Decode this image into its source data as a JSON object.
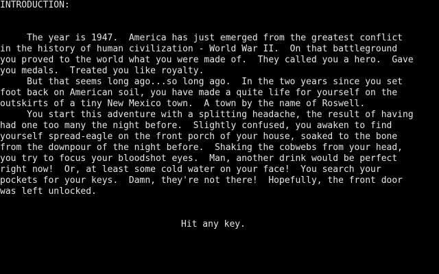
{
  "screen": {
    "heading": "INTRODUCTION:",
    "lines": [
      "     The year is 1947.  America has just emerged from the greatest conflict",
      "in the history of human civilization - World War II.  On that battleground",
      "you proved to the world what you were made of.  They called you a hero.  Gave",
      "you medals.  Treated you like royalty.",
      "     But that seems long ago...so long ago.  In the two years since you set",
      "foot back on American soil, you have made a quite life for yourself on the",
      "outskirts of a tiny New Mexico town.  A town by the name of Roswell.",
      "     You start this adventure with a splitting headache, the result of having",
      "had one too many the night before.  Slightly confused, you awaken to find",
      "yourself spread-eagle on the front porch of your house, soaked to the bone",
      "from the downpour of the night before.  Shaking the cobwebs from your head,",
      "you try to focus your bloodshot eyes.  Man, another drink would be perfect",
      "right now!  Or, at least some cold water on your face!  You search your",
      "pockets for your keys.  Damn, they're not there!  Hopefully, the front door",
      "was left unlocked."
    ],
    "prompt": "Hit any key."
  },
  "colors": {
    "background": "#000000",
    "text": "#e6e6e6"
  }
}
